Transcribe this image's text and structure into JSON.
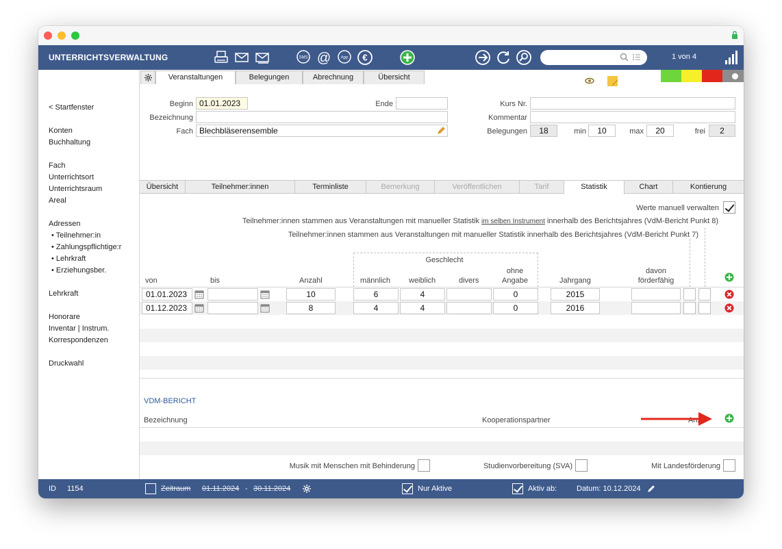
{
  "app": {
    "title": "UNTERRICHTSVERWALTUNG",
    "record_counter": "1 von 4",
    "search_placeholder": ""
  },
  "toolbar_icons": [
    "printer-icon",
    "mail-icon",
    "mail-list-icon",
    "sms-icon",
    "at-icon",
    "app-icon",
    "euro-icon",
    "add-icon",
    "arrow-right-icon",
    "refresh-icon",
    "search-icon"
  ],
  "status_colors": [
    "#6ed53b",
    "#f7ef2a",
    "#e3261c",
    "#8c8c8c"
  ],
  "sidebar": {
    "items": [
      {
        "label": "< Startfenster",
        "sub": false
      },
      {
        "label": "Konten",
        "sub": false
      },
      {
        "label": "Buchhaltung",
        "sub": false
      },
      {
        "label": "Fach",
        "sub": false
      },
      {
        "label": "Unterrichtsort",
        "sub": false
      },
      {
        "label": "Unterrichtsraum",
        "sub": false
      },
      {
        "label": "Areal",
        "sub": false
      },
      {
        "label": "Adressen",
        "sub": false
      },
      {
        "label": "• Teilnehmer:in",
        "sub": true
      },
      {
        "label": "• Zahlungspflichtige:r",
        "sub": true
      },
      {
        "label": "• Lehrkraft",
        "sub": true
      },
      {
        "label": "• Erziehungsber.",
        "sub": true
      },
      {
        "label": "Lehrkraft",
        "sub": false
      },
      {
        "label": "Honorare",
        "sub": false
      },
      {
        "label": "Inventar | Instrum.",
        "sub": false
      },
      {
        "label": "Korrespondenzen",
        "sub": false
      },
      {
        "label": "Druckwahl",
        "sub": false
      }
    ]
  },
  "top_tabs": [
    "Veranstaltungen",
    "Belegungen",
    "Abrechnung",
    "Übersicht"
  ],
  "form": {
    "beginn_label": "Beginn",
    "beginn_value": "01.01.2023",
    "ende_label": "Ende",
    "ende_value": "",
    "bezeichnung_label": "Bezeichnung",
    "bezeichnung_value": "",
    "fach_label": "Fach",
    "fach_value": "Blechbläserensemble",
    "kursnr_label": "Kurs Nr.",
    "kursnr_value": "",
    "kommentar_label": "Kommentar",
    "kommentar_value": "",
    "belegungen_label": "Belegungen",
    "belegungen_value": "18",
    "min_label": "min",
    "min_value": "10",
    "max_label": "max",
    "max_value": "20",
    "frei_label": "frei",
    "frei_value": "2"
  },
  "sub_tabs": [
    {
      "label": "Übersicht",
      "state": "normal"
    },
    {
      "label": "Teilnehmer:innen",
      "state": "normal"
    },
    {
      "label": "Terminliste",
      "state": "normal"
    },
    {
      "label": "Bemerkung",
      "state": "disabled"
    },
    {
      "label": "Veröffentlichen",
      "state": "disabled"
    },
    {
      "label": "Tarif",
      "state": "disabled"
    },
    {
      "label": "Statistik",
      "state": "active"
    },
    {
      "label": "Chart",
      "state": "normal"
    },
    {
      "label": "Kontierung",
      "state": "normal"
    }
  ],
  "statistik": {
    "manual_label": "Werte manuell verwalten",
    "manual_checked": true,
    "note1_pre": "Teilnehmer:innen stammen aus Veranstaltungen mit manueller Statistik",
    "note1_link": "im selben Instrument",
    "note1_post": "innerhalb des Berichtsjahres (VdM-Bericht Punkt 8)",
    "note2": "Teilnehmer:innen stammen aus Veranstaltungen mit manueller Statistik innerhalb des Berichtsjahres (VdM-Bericht Punkt 7)",
    "geschlecht_label": "Geschlecht",
    "columns": {
      "von": "von",
      "bis": "bis",
      "anzahl": "Anzahl",
      "maennlich": "männlich",
      "weiblich": "weiblich",
      "divers": "divers",
      "ohne1": "ohne",
      "ohne2": "Angabe",
      "jahrgang": "Jahrgang",
      "foerder1": "davon",
      "foerder2": "förderfähig"
    },
    "rows": [
      {
        "von": "01.01.2023",
        "bis": "",
        "anzahl": "10",
        "maennlich": "6",
        "weiblich": "4",
        "divers": "",
        "ohne": "0",
        "jahrgang": "2015",
        "foerder": ""
      },
      {
        "von": "01.12.2023",
        "bis": "",
        "anzahl": "8",
        "maennlich": "4",
        "weiblich": "4",
        "divers": "",
        "ohne": "0",
        "jahrgang": "2016",
        "foerder": ""
      }
    ]
  },
  "vdm": {
    "title": "VDM-BERICHT",
    "col_bezeichnung": "Bezeichnung",
    "col_koop": "Kooperationspartner",
    "col_anz": "Anz"
  },
  "footer_checks": {
    "behinderung": "Musik mit Menschen mit Behinderung",
    "sva": "Studienvorbereitung (SVA)",
    "landes": "Mit Landesförderung"
  },
  "bottombar": {
    "id_label": "ID",
    "id_value": "1154",
    "zeitraum_label": "Zeitraum",
    "zeitraum_from": "01.11.2024",
    "zeitraum_sep": "-",
    "zeitraum_to": "30.11.2024",
    "nur_aktive": "Nur Aktive",
    "aktiv_ab": "Aktiv ab:",
    "datum": "Datum: 10.12.2024"
  }
}
